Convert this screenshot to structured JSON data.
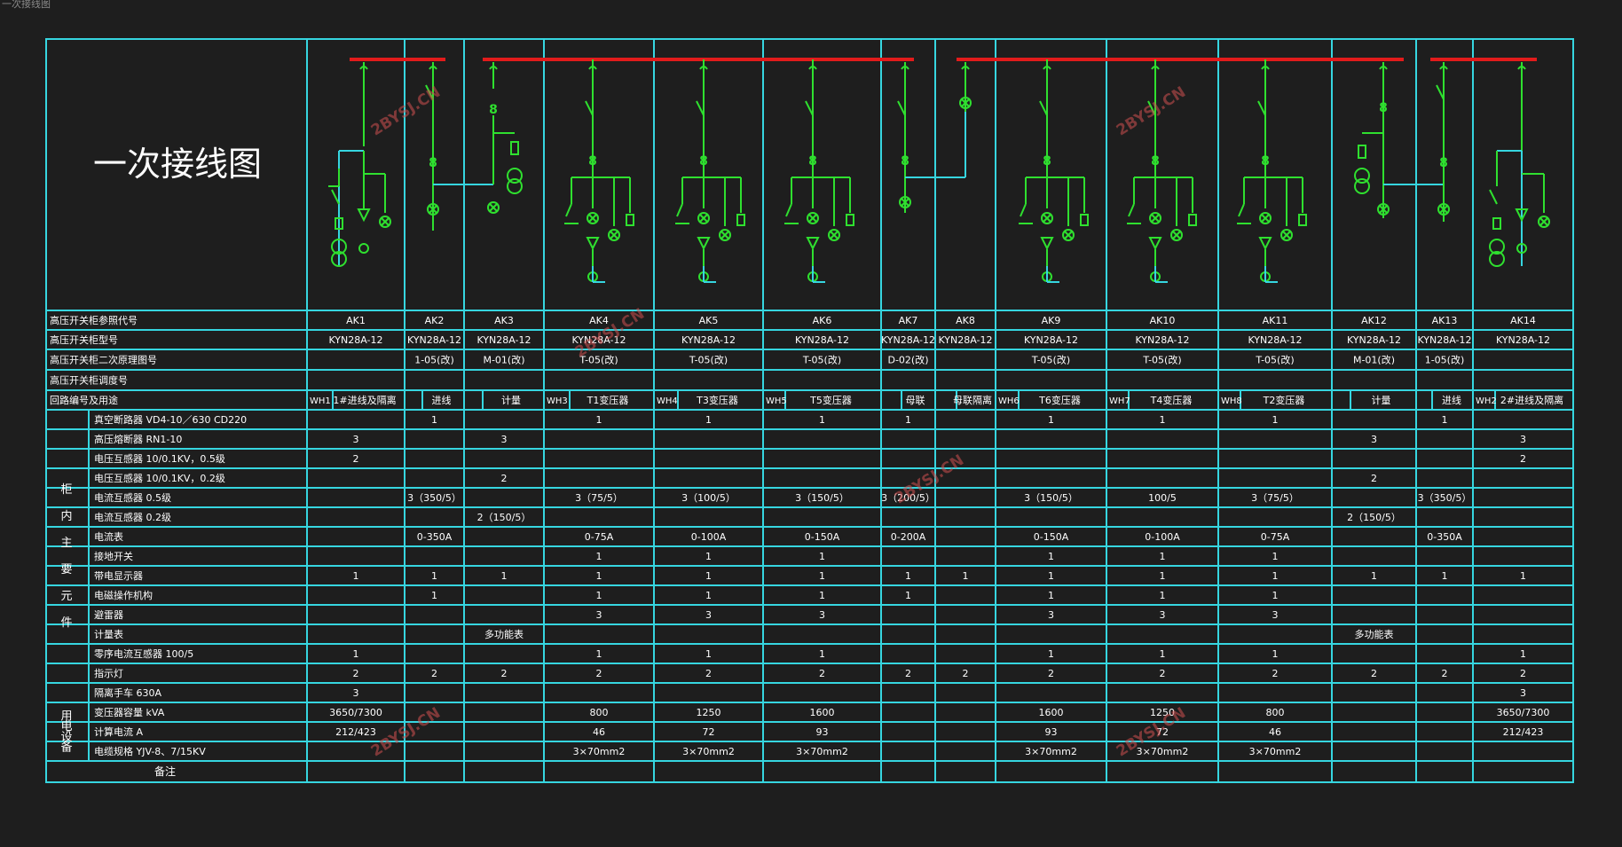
{
  "window_caption": "一次接线图",
  "title": "一次接线图",
  "watermark": "2BYSJ.CN",
  "colors": {
    "background": "#1e1e1e",
    "grid": "#36d6e0",
    "bus": "#e21b1b",
    "device": "#2fe02f",
    "text": "#ffffff"
  },
  "panels": [
    "AK1",
    "AK2",
    "AK3",
    "AK4",
    "AK5",
    "AK6",
    "AK7",
    "AK8",
    "AK9",
    "AK10",
    "AK11",
    "AK12",
    "AK13",
    "AK14"
  ],
  "info_rows": [
    {
      "label": "高压开关柜参照代号",
      "cells": [
        "AK1",
        "AK2",
        "AK3",
        "AK4",
        "AK5",
        "AK6",
        "AK7",
        "AK8",
        "AK9",
        "AK10",
        "AK11",
        "AK12",
        "AK13",
        "AK14"
      ]
    },
    {
      "label": "高压开关柜型号",
      "cells": [
        "KYN28A-12",
        "KYN28A-12",
        "KYN28A-12",
        "KYN28A-12",
        "KYN28A-12",
        "KYN28A-12",
        "KYN28A-12",
        "KYN28A-12",
        "KYN28A-12",
        "KYN28A-12",
        "KYN28A-12",
        "KYN28A-12",
        "KYN28A-12",
        "KYN28A-12"
      ]
    },
    {
      "label": "高压开关柜二次原理图号",
      "cells": [
        "",
        "1-05(改)",
        "M-01(改)",
        "T-05(改)",
        "T-05(改)",
        "T-05(改)",
        "D-02(改)",
        "",
        "T-05(改)",
        "T-05(改)",
        "T-05(改)",
        "M-01(改)",
        "1-05(改)",
        ""
      ]
    },
    {
      "label": "高压开关柜调度号",
      "cells": [
        "",
        "",
        "",
        "",
        "",
        "",
        "",
        "",
        "",
        "",
        "",
        "",
        "",
        ""
      ]
    }
  ],
  "circuit_row": {
    "label": "回路编号及用途",
    "cells": [
      {
        "code": "WH1",
        "use": "1#进线及隔离"
      },
      {
        "code": "",
        "use": "进线"
      },
      {
        "code": "",
        "use": "计量"
      },
      {
        "code": "WH3",
        "use": "T1变压器"
      },
      {
        "code": "WH4",
        "use": "T3变压器"
      },
      {
        "code": "WH5",
        "use": "T5变压器"
      },
      {
        "code": "",
        "use": "母联"
      },
      {
        "code": "",
        "use": "母联隔离"
      },
      {
        "code": "WH6",
        "use": "T6变压器"
      },
      {
        "code": "WH7",
        "use": "T4变压器"
      },
      {
        "code": "WH8",
        "use": "T2变压器"
      },
      {
        "code": "",
        "use": "计量"
      },
      {
        "code": "",
        "use": "进线"
      },
      {
        "code": "WH2",
        "use": "2#进线及隔离"
      }
    ]
  },
  "group1_label": "柜内主要元件",
  "components": [
    {
      "label": "真空断路器 VD4-10／630 CD220",
      "cells": [
        "",
        "1",
        "",
        "1",
        "1",
        "1",
        "1",
        "",
        "1",
        "1",
        "1",
        "",
        "1",
        ""
      ]
    },
    {
      "label": "高压熔断器 RN1-10",
      "cells": [
        "3",
        "",
        "3",
        "",
        "",
        "",
        "",
        "",
        "",
        "",
        "",
        "3",
        "",
        "3"
      ]
    },
    {
      "label": "电压互感器 10/0.1KV，0.5级",
      "cells": [
        "2",
        "",
        "",
        "",
        "",
        "",
        "",
        "",
        "",
        "",
        "",
        "",
        "",
        "2"
      ]
    },
    {
      "label": "电压互感器 10/0.1KV，0.2级",
      "cells": [
        "",
        "",
        "2",
        "",
        "",
        "",
        "",
        "",
        "",
        "",
        "",
        "2",
        "",
        ""
      ]
    },
    {
      "label": "电流互感器 0.5级",
      "cells": [
        "",
        "3（350/5）",
        "",
        "3（75/5）",
        "3（100/5）",
        "3（150/5）",
        "3（200/5）",
        "",
        "3（150/5）",
        "100/5",
        "3（75/5）",
        "",
        "3（350/5）",
        ""
      ]
    },
    {
      "label": "电流互感器 0.2级",
      "cells": [
        "",
        "",
        "2（150/5）",
        "",
        "",
        "",
        "",
        "",
        "",
        "",
        "",
        "2（150/5）",
        "",
        ""
      ]
    },
    {
      "label": "电流表",
      "cells": [
        "",
        "0-350A",
        "",
        "0-75A",
        "0-100A",
        "0-150A",
        "0-200A",
        "",
        "0-150A",
        "0-100A",
        "0-75A",
        "",
        "0-350A",
        ""
      ]
    },
    {
      "label": "接地开关",
      "cells": [
        "",
        "",
        "",
        "1",
        "1",
        "1",
        "",
        "",
        "1",
        "1",
        "1",
        "",
        "",
        ""
      ]
    },
    {
      "label": "带电显示器",
      "cells": [
        "1",
        "1",
        "1",
        "1",
        "1",
        "1",
        "1",
        "1",
        "1",
        "1",
        "1",
        "1",
        "1",
        "1"
      ]
    },
    {
      "label": "电磁操作机构",
      "cells": [
        "",
        "1",
        "",
        "1",
        "1",
        "1",
        "1",
        "",
        "1",
        "1",
        "1",
        "",
        "",
        ""
      ]
    },
    {
      "label": "避雷器",
      "cells": [
        "",
        "",
        "",
        "3",
        "3",
        "3",
        "",
        "",
        "3",
        "3",
        "3",
        "",
        "",
        ""
      ]
    },
    {
      "label": "计量表",
      "cells": [
        "",
        "",
        "多功能表",
        "",
        "",
        "",
        "",
        "",
        "",
        "",
        "",
        "多功能表",
        "",
        ""
      ]
    },
    {
      "label": "零序电流互感器 100/5",
      "cells": [
        "1",
        "",
        "",
        "1",
        "1",
        "1",
        "",
        "",
        "1",
        "1",
        "1",
        "",
        "",
        "1"
      ]
    },
    {
      "label": "指示灯",
      "cells": [
        "2",
        "2",
        "2",
        "2",
        "2",
        "2",
        "2",
        "2",
        "2",
        "2",
        "2",
        "2",
        "2",
        "2"
      ]
    },
    {
      "label": "隔离手车 630A",
      "cells": [
        "3",
        "",
        "",
        "",
        "",
        "",
        "",
        "",
        "",
        "",
        "",
        "",
        "",
        "3"
      ]
    }
  ],
  "group2_label": "用电设备",
  "equipment": [
    {
      "label": "变压器容量 kVA",
      "cells": [
        "3650/7300",
        "",
        "",
        "800",
        "1250",
        "1600",
        "",
        "",
        "1600",
        "1250",
        "800",
        "",
        "",
        "3650/7300"
      ]
    },
    {
      "label": "计算电流 A",
      "cells": [
        "212/423",
        "",
        "",
        "46",
        "72",
        "93",
        "",
        "",
        "93",
        "72",
        "46",
        "",
        "",
        "212/423"
      ]
    },
    {
      "label": "电缆规格 YJV-8、7/15KV",
      "cells": [
        "",
        "",
        "",
        "3×70mm2",
        "3×70mm2",
        "3×70mm2",
        "",
        "",
        "3×70mm2",
        "3×70mm2",
        "3×70mm2",
        "",
        "",
        ""
      ]
    }
  ],
  "remarks_label": "备注"
}
